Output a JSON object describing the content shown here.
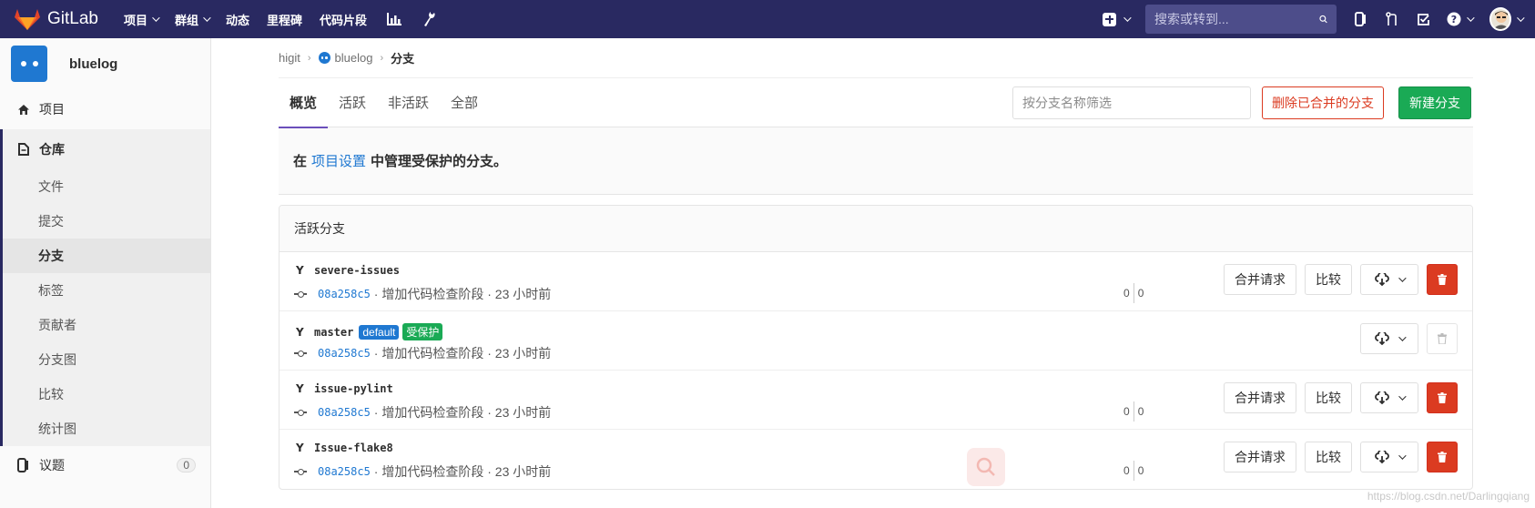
{
  "brand": {
    "name": "GitLab"
  },
  "topnav": {
    "items": [
      {
        "label": "项目",
        "dropdown": true
      },
      {
        "label": "群组",
        "dropdown": true
      },
      {
        "label": "动态",
        "dropdown": false
      },
      {
        "label": "里程碑",
        "dropdown": false
      },
      {
        "label": "代码片段",
        "dropdown": false
      }
    ],
    "icons": [
      "chart-icon",
      "wrench-icon"
    ]
  },
  "header_right": {
    "search_placeholder": "搜索或转到...",
    "icons": [
      "plus-square-icon",
      "search-icon",
      "issues-icon",
      "merge-request-icon",
      "todo-icon",
      "help-icon",
      "avatar"
    ]
  },
  "sidebar": {
    "project_name": "bluelog",
    "items": {
      "project": "项目",
      "repository": "仓库",
      "issues": "议题",
      "issues_count": "0"
    },
    "sub_items": [
      "文件",
      "提交",
      "分支",
      "标签",
      "贡献者",
      "分支图",
      "比较",
      "统计图"
    ],
    "active_sub": "分支"
  },
  "breadcrumb": {
    "group": "higit",
    "project": "bluelog",
    "current": "分支"
  },
  "tabs": [
    "概览",
    "活跃",
    "非活跃",
    "全部"
  ],
  "filter_placeholder": "按分支名称筛选",
  "buttons": {
    "delete_merged": "删除已合并的分支",
    "new_branch": "新建分支"
  },
  "info": {
    "prefix": "在",
    "link": "项目设置",
    "suffix": "中管理受保护的分支。"
  },
  "section_title": "活跃分支",
  "branches": [
    {
      "name": "severe-issues",
      "sha": "08a258c5",
      "message": "· 增加代码检查阶段 · 23 小时前",
      "behind": "0",
      "ahead": "0",
      "merge_label": "合并请求",
      "compare_label": "比较"
    },
    {
      "name": "master",
      "sha": "08a258c5",
      "message": "· 增加代码检查阶段 · 23 小时前",
      "badge_default": "default",
      "badge_protected": "受保护"
    },
    {
      "name": "issue-pylint",
      "sha": "08a258c5",
      "message": "· 增加代码检查阶段 · 23 小时前",
      "behind": "0",
      "ahead": "0",
      "merge_label": "合并请求",
      "compare_label": "比较"
    },
    {
      "name": "Issue-flake8",
      "sha": "08a258c5",
      "message": "· 增加代码检查阶段 · 23 小时前",
      "behind": "0",
      "ahead": "0",
      "merge_label": "合并请求",
      "compare_label": "比较"
    }
  ],
  "watermark": "https://blog.csdn.net/Darlingqiang",
  "colors": {
    "navbar": "#292961",
    "link": "#1f78d1",
    "danger": "#db3b21",
    "success": "#1aaa55"
  }
}
